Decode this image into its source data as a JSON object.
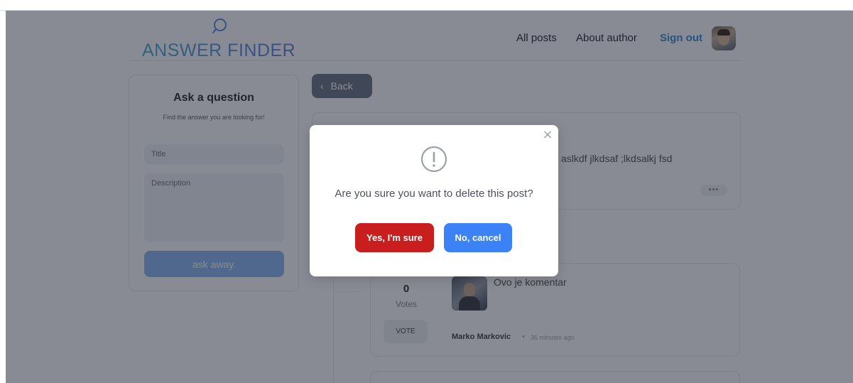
{
  "header": {
    "logo_text": "ANSWER FINDER",
    "nav": {
      "all_posts": "All posts",
      "about_author": "About author",
      "sign_out": "Sign out"
    }
  },
  "ask_card": {
    "title": "Ask a question",
    "subtitle": "Find the answer you are looking for!",
    "title_placeholder": "Title",
    "description_placeholder": "Description",
    "submit_label": "ask away."
  },
  "post": {
    "back_label": "Back",
    "visible_text": "aslkdf jlkdsaf ;lkdsalkj fsd",
    "more_label": "•••"
  },
  "comment": {
    "votes": "0",
    "votes_label": "Votes",
    "vote_button": "VOTE",
    "text": "Ovo je komentar",
    "author": "Marko Markovic",
    "separator": "•",
    "time": "36 minutes ago"
  },
  "modal": {
    "close_label": "×",
    "message": "Are you sure you want to delete this post?",
    "confirm_label": "Yes, I'm sure",
    "cancel_label": "No, cancel"
  },
  "colors": {
    "confirm": "#c81e1e",
    "cancel": "#3b82f6",
    "sign_out": "#3f8fd8",
    "overlay": "rgba(17,24,39,0.5)"
  }
}
